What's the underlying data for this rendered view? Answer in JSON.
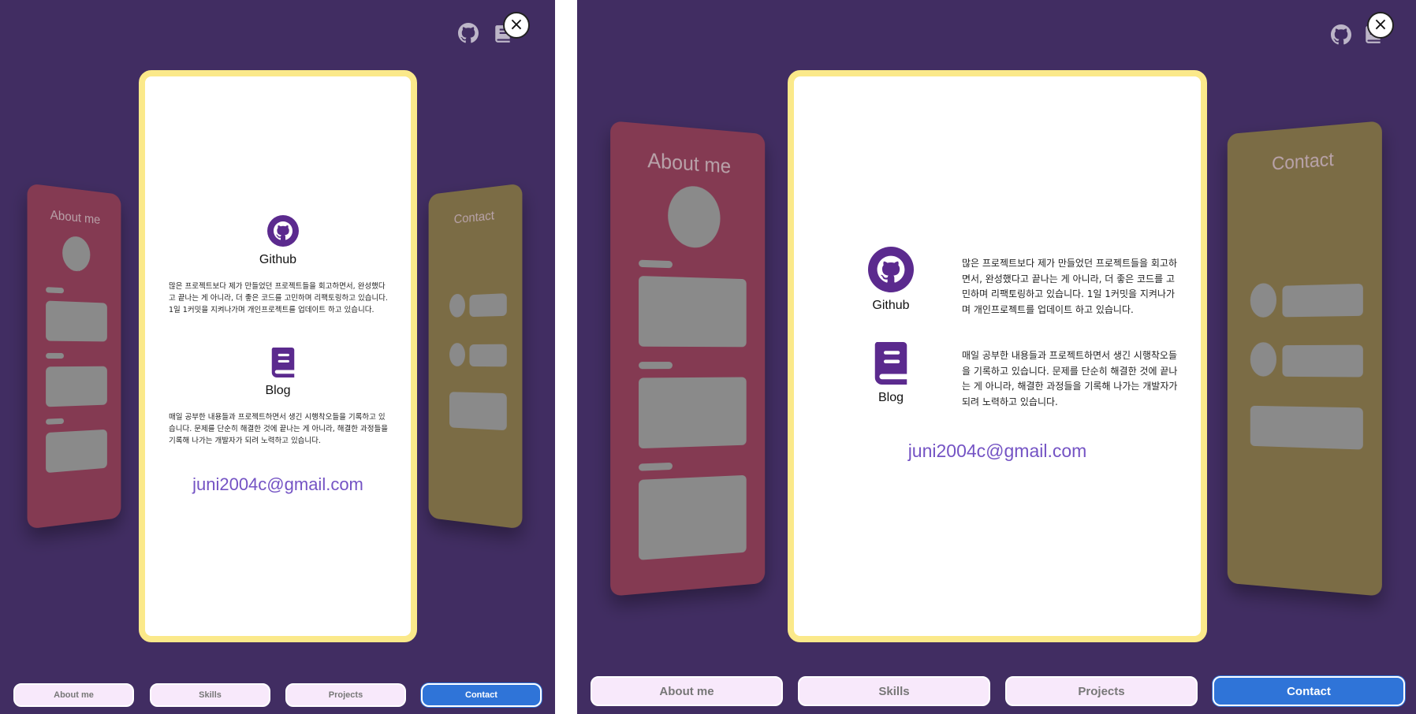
{
  "colors": {
    "background": "#412d62",
    "card_border": "#fbe98a",
    "about_card": "#843a52",
    "contact_card": "#7b6c45",
    "email": "#7453c4",
    "nav_inactive": "#f8e9fb",
    "nav_active": "#2f74d8"
  },
  "header": {
    "github_icon": "github-icon",
    "blog_icon": "book-icon",
    "close_label": "×"
  },
  "cards": {
    "about_title": "About me",
    "contact_title": "Contact"
  },
  "contact": {
    "github_label": "Github",
    "github_text": "많은 프로젝트보다 제가 만들었던 프로젝트들을 회고하면서, 완성했다고 끝나는 게 아니라, 더 좋은 코드를 고민하며 리팩토링하고 있습니다. 1일 1커밋을 지켜나가며 개인프로젝트를 업데이트 하고 있습니다.",
    "blog_label": "Blog",
    "blog_text": "매일 공부한 내용들과 프로젝트하면서 생긴 시행착오들을 기록하고 있습니다. 문제를 단순히 해결한 것에 끝나는 게 아니라, 해결한 과정들을 기록해 나가는 개발자가 되려 노력하고 있습니다.",
    "email": "juni2004c@gmail.com"
  },
  "nav": {
    "about": "About me",
    "skills": "Skills",
    "projects": "Projects",
    "contact": "Contact",
    "active": "Contact"
  }
}
